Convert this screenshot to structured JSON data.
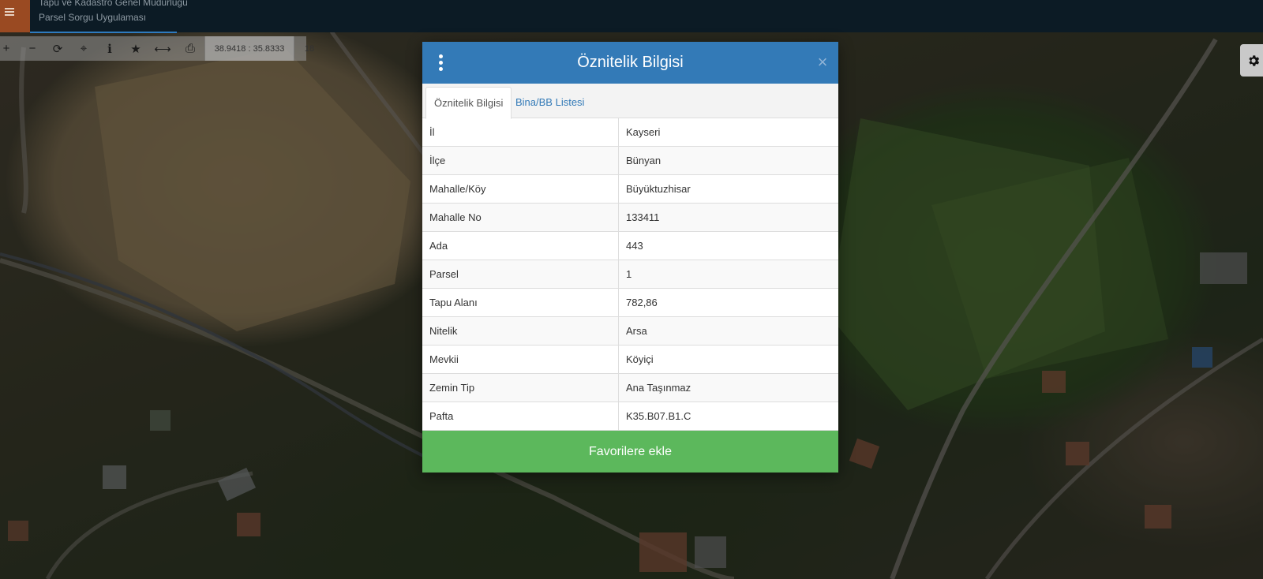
{
  "header": {
    "org_name": "Tapu ve Kadastro Genel Müdürlüğü",
    "app_name": "Parsel Sorgu Uygulaması",
    "menu_icon": "hamburger-icon"
  },
  "toolbar": {
    "tools": [
      {
        "name": "zoom-in-icon",
        "glyph": "+"
      },
      {
        "name": "zoom-out-icon",
        "glyph": "−"
      },
      {
        "name": "refresh-icon",
        "glyph": "⟳"
      },
      {
        "name": "locate-icon",
        "glyph": "⌖"
      },
      {
        "name": "info-icon",
        "glyph": "i"
      },
      {
        "name": "favorite-star-icon",
        "glyph": "★"
      },
      {
        "name": "measure-icon",
        "glyph": "⟷"
      },
      {
        "name": "print-icon",
        "glyph": "⎙"
      }
    ],
    "coordinates": "38.9418 : 35.8333",
    "zoom_level": "18",
    "settings_icon": "gear-icon"
  },
  "modal": {
    "title": "Öznitelik Bilgisi",
    "menu_icon": "kebab-menu-icon",
    "close_glyph": "×",
    "tabs": [
      {
        "label": "Öznitelik Bilgisi",
        "active": true
      },
      {
        "label": "Bina/BB Listesi",
        "active": false
      }
    ],
    "rows": [
      {
        "key": "İl",
        "value": "Kayseri"
      },
      {
        "key": "İlçe",
        "value": "Bünyan"
      },
      {
        "key": "Mahalle/Köy",
        "value": "Büyüktuzhisar"
      },
      {
        "key": "Mahalle No",
        "value": "133411"
      },
      {
        "key": "Ada",
        "value": "443"
      },
      {
        "key": "Parsel",
        "value": "1"
      },
      {
        "key": "Tapu Alanı",
        "value": "782,86"
      },
      {
        "key": "Nitelik",
        "value": "Arsa"
      },
      {
        "key": "Mevkii",
        "value": "Köyiçi"
      },
      {
        "key": "Zemin Tip",
        "value": "Ana Taşınmaz"
      },
      {
        "key": "Pafta",
        "value": "K35.B07.B1.C"
      }
    ],
    "favorite_button": "Favorilere ekle"
  },
  "colors": {
    "header_bg": "#0c1b25",
    "menu_button": "#9a4a22",
    "modal_header": "#337ab7",
    "favorite_button": "#5cb85c",
    "tab_link": "#337ab7"
  }
}
